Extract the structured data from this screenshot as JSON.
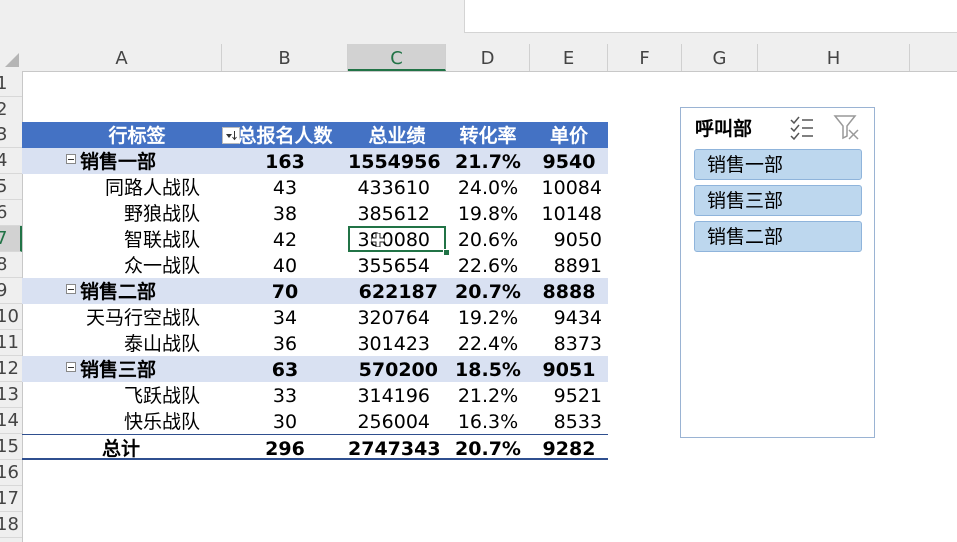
{
  "columns": [
    "A",
    "B",
    "C",
    "D",
    "E",
    "F",
    "G",
    "H"
  ],
  "rows": [
    "1",
    "2",
    "3",
    "4",
    "5",
    "6",
    "7",
    "8",
    "9",
    "10",
    "11",
    "12",
    "13",
    "14",
    "15",
    "16",
    "17",
    "18"
  ],
  "selected_column": "C",
  "selected_row": "7",
  "pivot": {
    "headers": {
      "row_label": "行标签",
      "registrants": "总报名人数",
      "sales": "总业绩",
      "conversion": "转化率",
      "unit_price": "单价"
    },
    "rows": [
      {
        "label": "销售一部",
        "registrants": "163",
        "sales": "1554956",
        "conversion": "21.7%",
        "unit_price": "9540",
        "level": "dept"
      },
      {
        "label": "同路人战队",
        "registrants": "43",
        "sales": "433610",
        "conversion": "24.0%",
        "unit_price": "10084",
        "level": "team"
      },
      {
        "label": "野狼战队",
        "registrants": "38",
        "sales": "385612",
        "conversion": "19.8%",
        "unit_price": "10148",
        "level": "team"
      },
      {
        "label": "智联战队",
        "registrants": "42",
        "sales": "380080",
        "conversion": "20.6%",
        "unit_price": "9050",
        "level": "team"
      },
      {
        "label": "众一战队",
        "registrants": "40",
        "sales": "355654",
        "conversion": "22.6%",
        "unit_price": "8891",
        "level": "team"
      },
      {
        "label": "销售二部",
        "registrants": "70",
        "sales": "622187",
        "conversion": "20.7%",
        "unit_price": "8888",
        "level": "dept"
      },
      {
        "label": "天马行空战队",
        "registrants": "34",
        "sales": "320764",
        "conversion": "19.2%",
        "unit_price": "9434",
        "level": "team"
      },
      {
        "label": "泰山战队",
        "registrants": "36",
        "sales": "301423",
        "conversion": "22.4%",
        "unit_price": "8373",
        "level": "team"
      },
      {
        "label": "销售三部",
        "registrants": "63",
        "sales": "570200",
        "conversion": "18.5%",
        "unit_price": "9051",
        "level": "dept"
      },
      {
        "label": "飞跃战队",
        "registrants": "33",
        "sales": "314196",
        "conversion": "21.2%",
        "unit_price": "9521",
        "level": "team"
      },
      {
        "label": "快乐战队",
        "registrants": "30",
        "sales": "256004",
        "conversion": "16.3%",
        "unit_price": "8533",
        "level": "team"
      }
    ],
    "total": {
      "label": "总计",
      "registrants": "296",
      "sales": "2747343",
      "conversion": "20.7%",
      "unit_price": "9282"
    }
  },
  "slicer": {
    "title": "呼叫部",
    "items": [
      "销售一部",
      "销售三部",
      "销售二部"
    ],
    "selected_color": "#bdd7ee"
  },
  "colors": {
    "header_bg": "#4472c4",
    "dept_bg": "#d9e1f2",
    "selection": "#217346"
  },
  "icons": {
    "multi_select": "multi-select-icon",
    "clear_filter": "clear-filter-icon",
    "filter_button": "filter-dropdown-icon"
  }
}
